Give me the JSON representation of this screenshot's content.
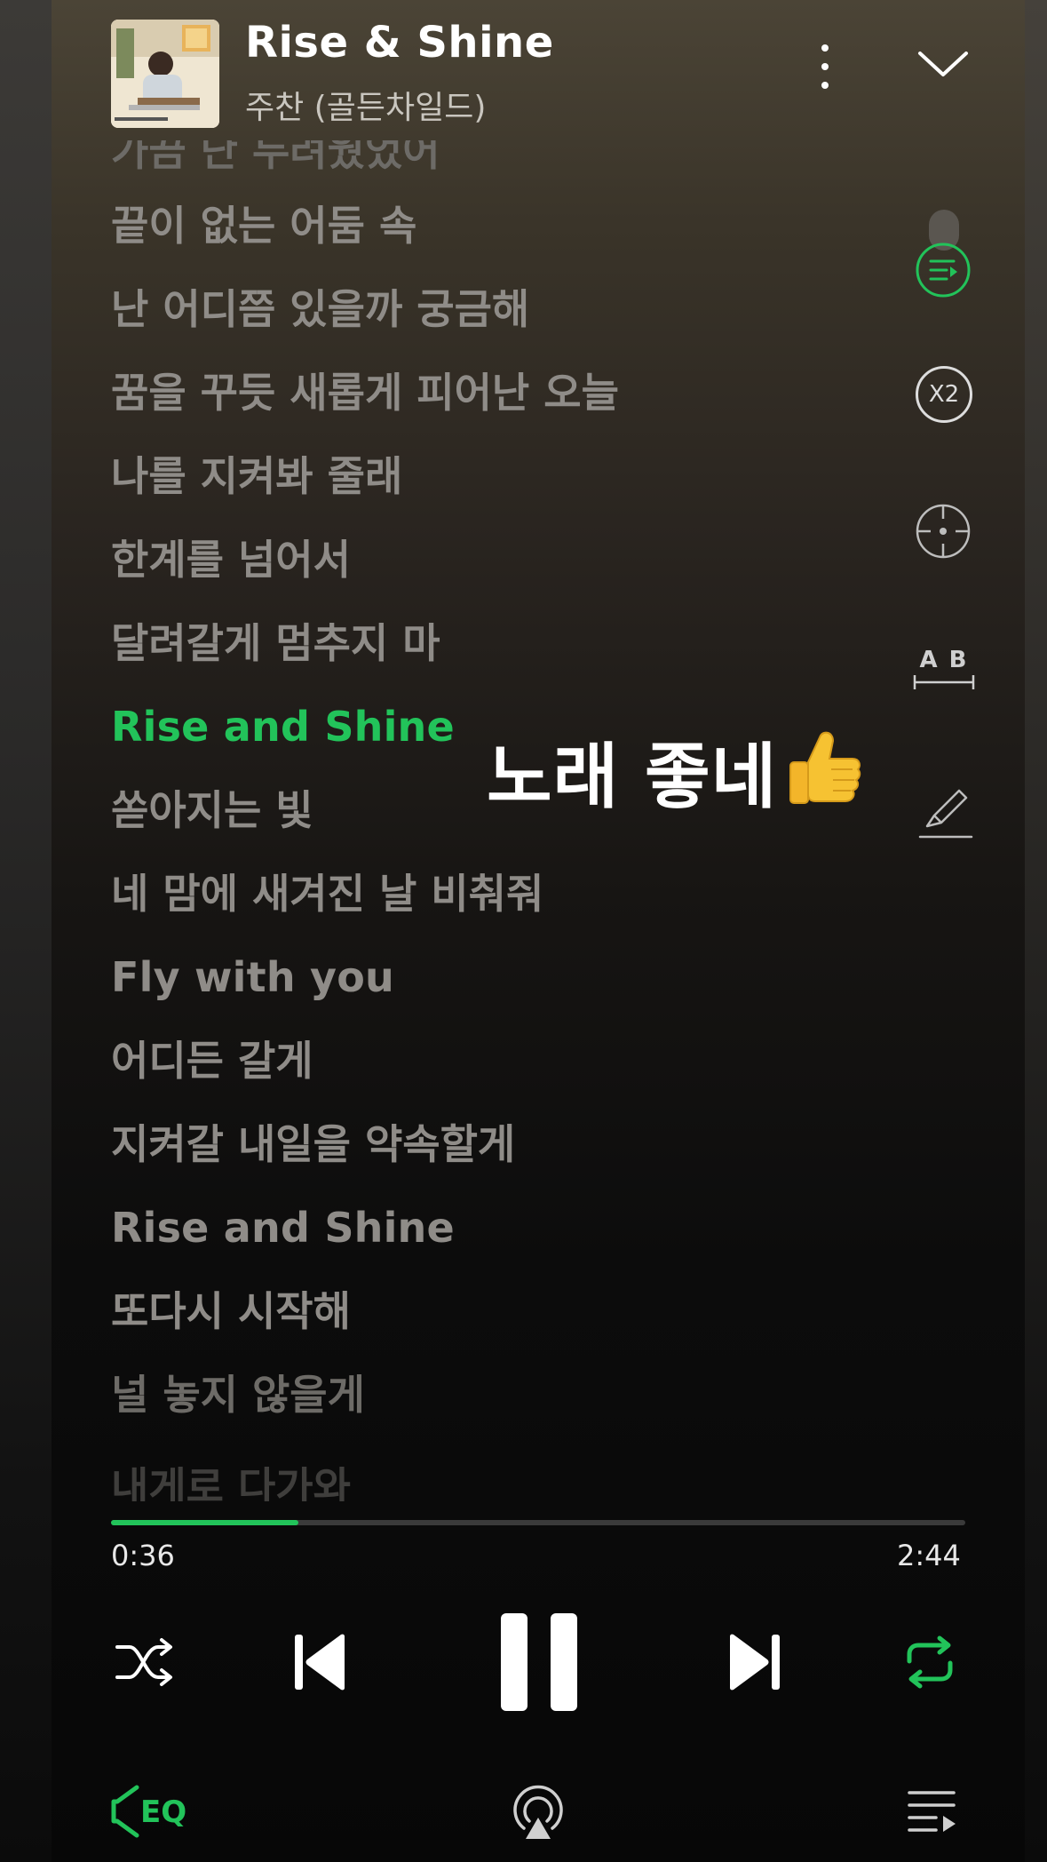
{
  "track": {
    "title": "Rise & Shine",
    "artist": "주찬 (골든차일드)"
  },
  "lyrics": [
    {
      "text": "가끔 난 두려웠었어",
      "state": "fade1"
    },
    {
      "text": "끝이 없는 어둠 속",
      "state": "normal"
    },
    {
      "text": "난 어디쯤 있을까 궁금해",
      "state": "normal"
    },
    {
      "text": "꿈을 꾸듯 새롭게 피어난 오늘",
      "state": "normal"
    },
    {
      "text": "나를 지켜봐 줄래",
      "state": "normal"
    },
    {
      "text": "한계를 넘어서",
      "state": "normal"
    },
    {
      "text": "달려갈게 멈추지 마",
      "state": "normal"
    },
    {
      "text": "Rise and Shine",
      "state": "active"
    },
    {
      "text": "쏟아지는 빛",
      "state": "normal"
    },
    {
      "text": "네 맘에 새겨진 날 비춰줘",
      "state": "normal"
    },
    {
      "text": "Fly with you",
      "state": "normal"
    },
    {
      "text": "어디든 갈게",
      "state": "normal"
    },
    {
      "text": "지켜갈 내일을 약속할게",
      "state": "normal"
    },
    {
      "text": "Rise and Shine",
      "state": "normal"
    },
    {
      "text": "또다시 시작해",
      "state": "normal"
    },
    {
      "text": "널 놓지 않을게",
      "state": "fade1"
    },
    {
      "text": "내게로 다가와",
      "state": "fade2"
    }
  ],
  "overlay": {
    "comment": "노래 좋네",
    "emoji": "thumbs-up"
  },
  "side_controls": {
    "speed_label": "X2",
    "ab_label": "A B"
  },
  "playback": {
    "elapsed": "0:36",
    "total": "2:44",
    "progress_fraction": 0.2195
  },
  "bottom_bar": {
    "eq_label": "EQ"
  },
  "colors": {
    "accent": "#22c35a",
    "lyric_inactive": "#8f8c88",
    "text_primary": "#ffffff"
  },
  "icons": [
    "more-vertical-icon",
    "chevron-down-icon",
    "lyrics-mode-icon",
    "speed-icon",
    "target-icon",
    "ab-repeat-icon",
    "highlighter-icon",
    "shuffle-icon",
    "previous-icon",
    "pause-icon",
    "next-icon",
    "repeat-icon",
    "eq-icon",
    "airplay-icon",
    "queue-icon"
  ]
}
